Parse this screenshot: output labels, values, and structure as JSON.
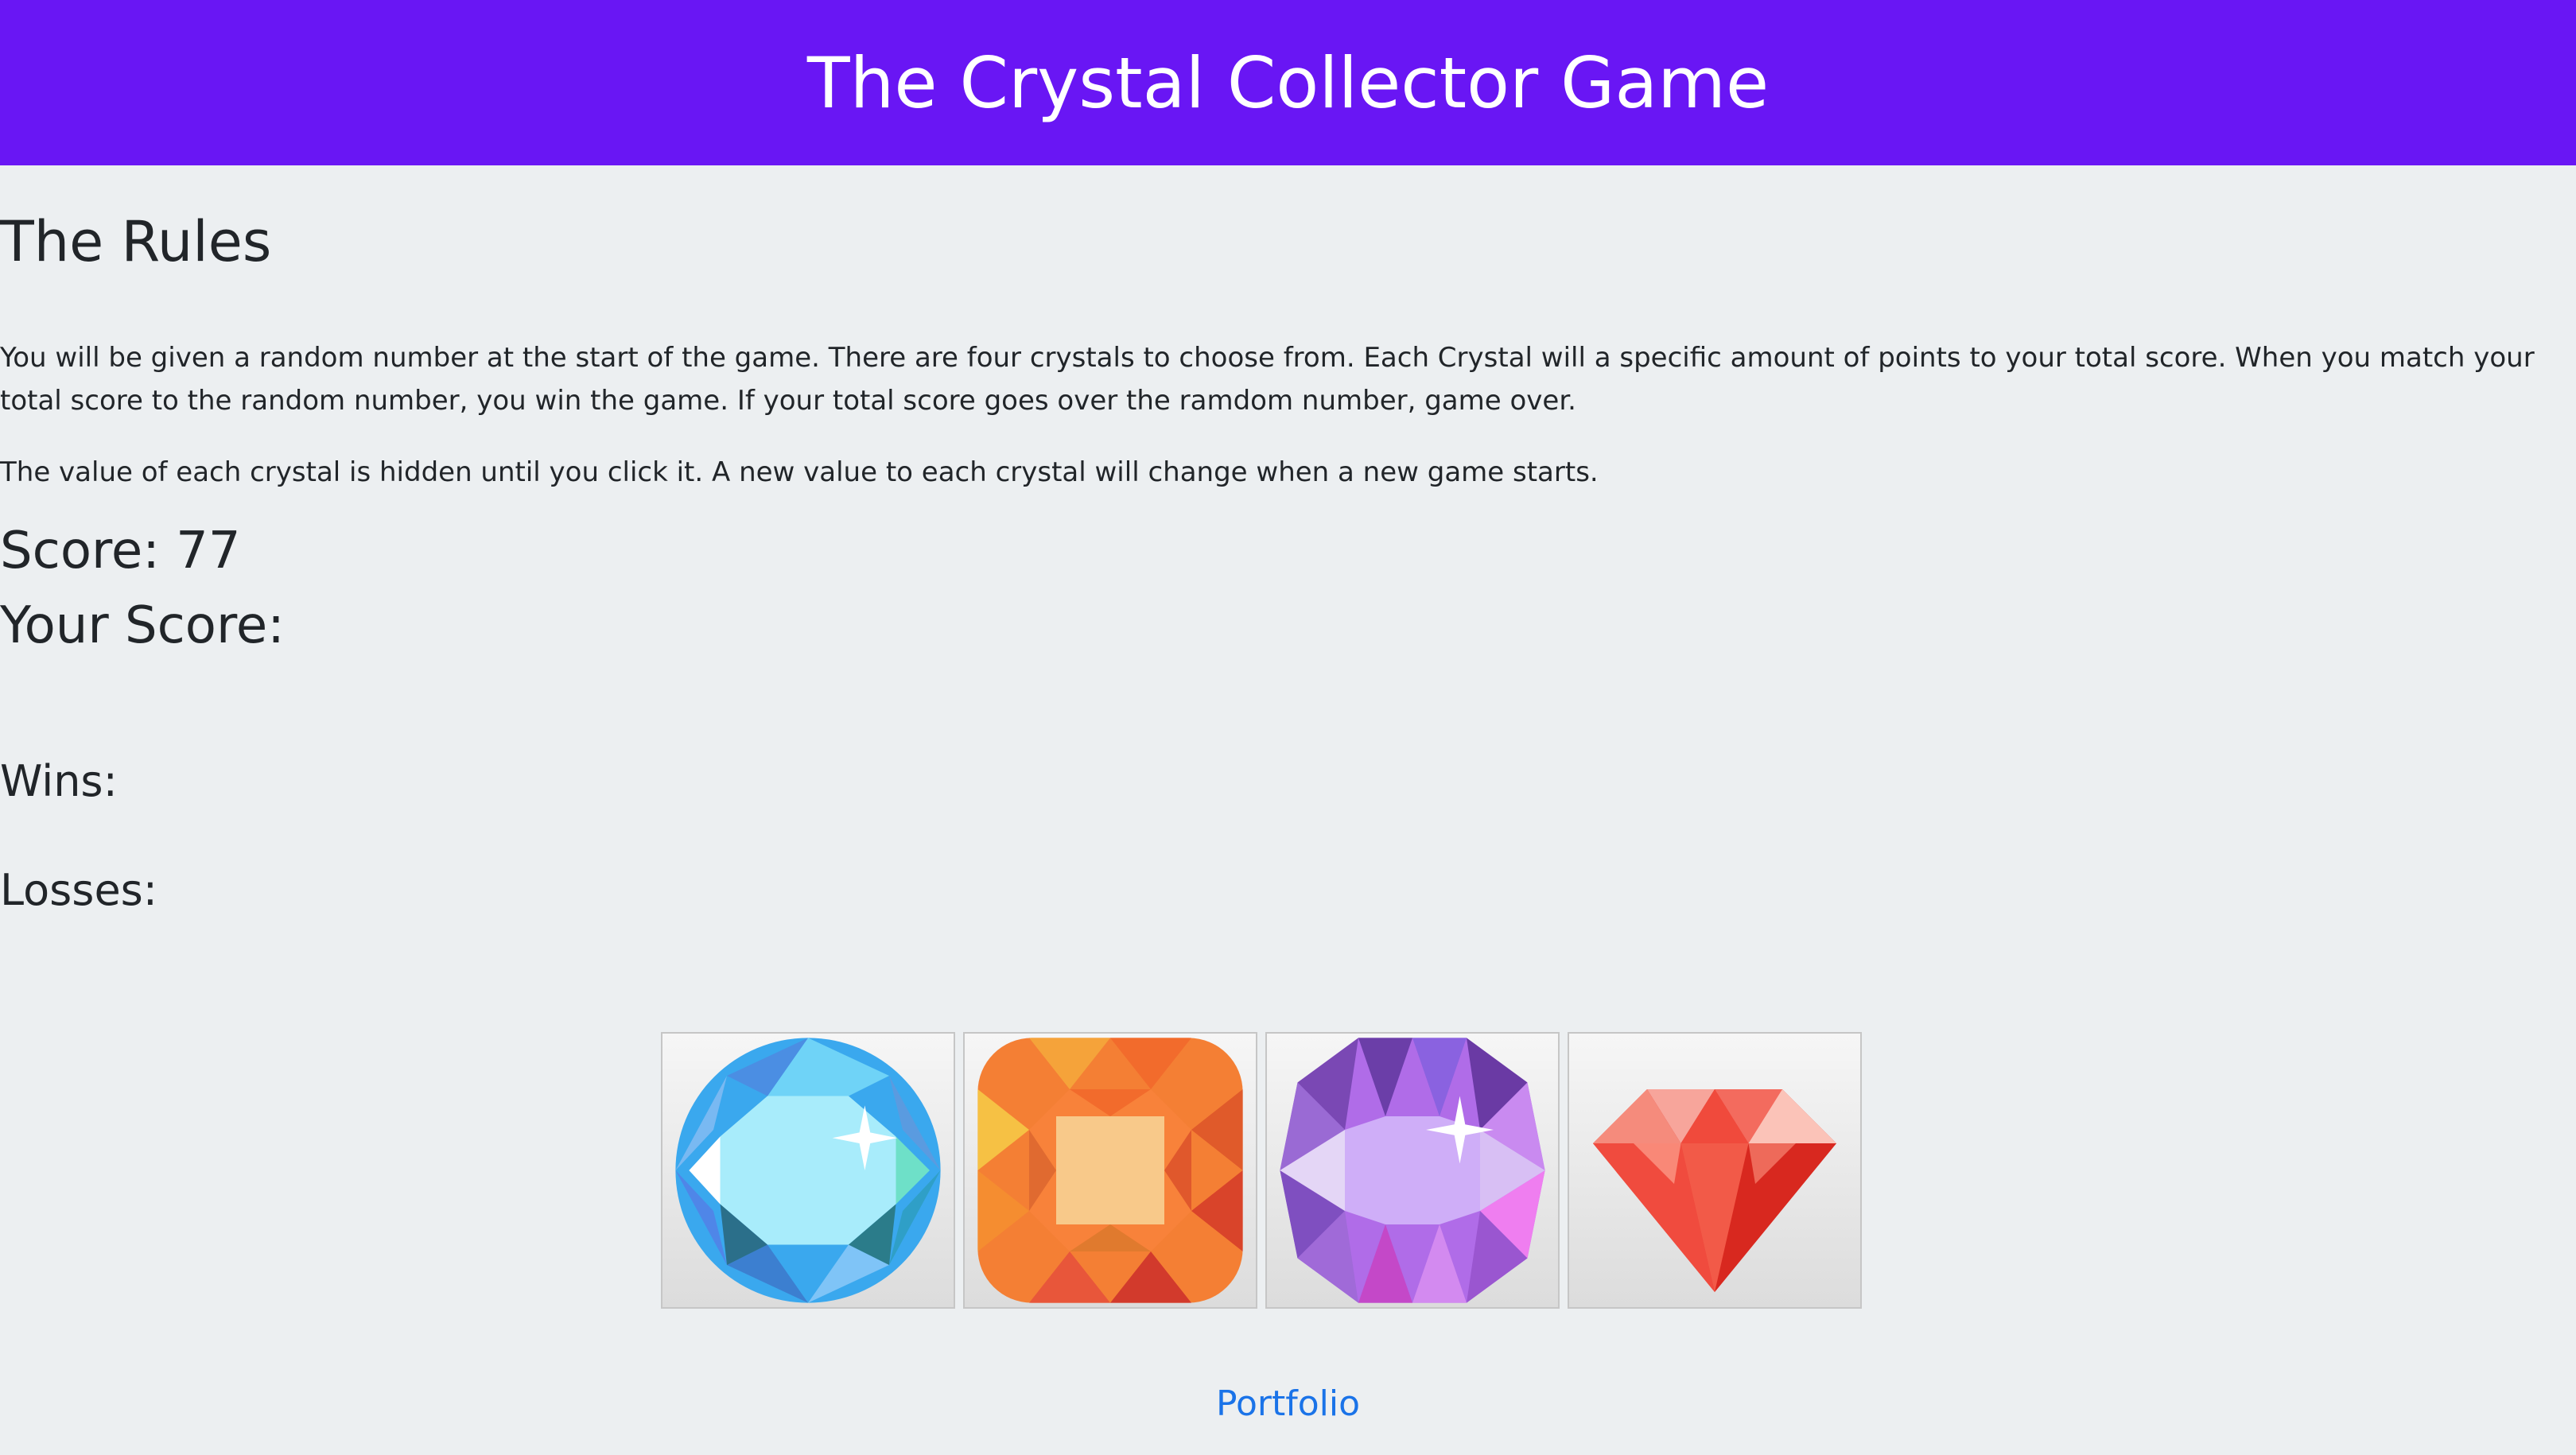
{
  "header": {
    "title": "The Crystal Collector Game"
  },
  "rules": {
    "title": "The Rules",
    "paragraph1": "You will be given a random number at the start of the game. There are four crystals to choose from. Each Crystal will a specific amount of points to your total score. When you match your total score to the random number, you win the game. If your total score goes over the ramdom number, game over.",
    "paragraph2": "The value of each crystal is hidden until you click it. A new value to each crystal will change when a new game starts."
  },
  "stats": {
    "score_label": "Score: 77",
    "your_score_label": "Your Score:",
    "wins_label": "Wins:",
    "losses_label": "Losses:"
  },
  "crystals": [
    {
      "icon": "blue-crystal-icon",
      "color": "#3aa8ee"
    },
    {
      "icon": "orange-crystal-icon",
      "color": "#f47f34"
    },
    {
      "icon": "purple-crystal-icon",
      "color": "#b06ce8"
    },
    {
      "icon": "red-crystal-icon",
      "color": "#e8362e"
    }
  ],
  "footer": {
    "link_label": "Portfolio"
  }
}
